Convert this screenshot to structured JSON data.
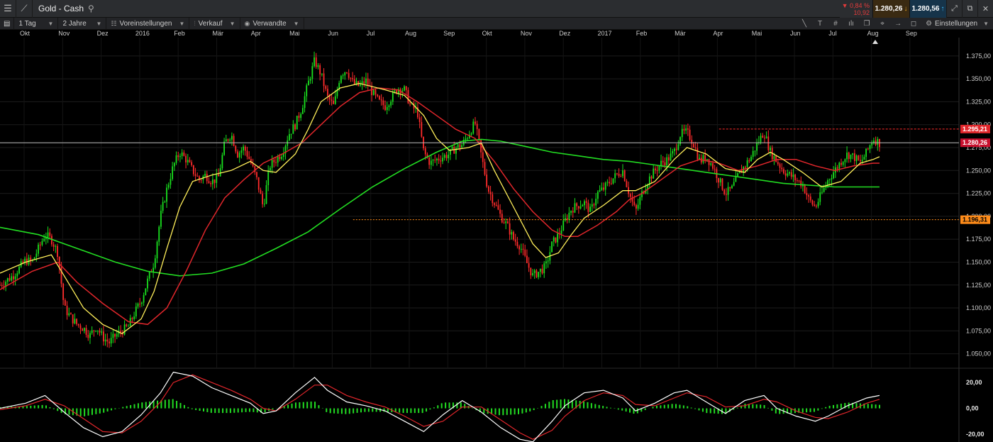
{
  "titlebar": {
    "instrument": "Gold - Cash",
    "change_pct": "▼ 0,84 %",
    "change_abs": "10,92",
    "bid": "1.280,26",
    "ask": "1.280,56"
  },
  "toolbar": {
    "interval": "1 Tag",
    "range": "2 Jahre",
    "presets": "Voreinstellungen",
    "sell": "Verkauf",
    "related": "Verwandte",
    "settings": "Einstellungen"
  },
  "months": [
    {
      "label": "Okt"
    },
    {
      "label": "Nov"
    },
    {
      "label": "Dez"
    },
    {
      "label": "2016"
    },
    {
      "label": "Feb"
    },
    {
      "label": "Mär"
    },
    {
      "label": "Apr"
    },
    {
      "label": "Mai"
    },
    {
      "label": "Jun"
    },
    {
      "label": "Jul"
    },
    {
      "label": "Aug"
    },
    {
      "label": "Sep"
    },
    {
      "label": "Okt"
    },
    {
      "label": "Nov"
    },
    {
      "label": "Dez"
    },
    {
      "label": "2017"
    },
    {
      "label": "Feb"
    },
    {
      "label": "Mär"
    },
    {
      "label": "Apr"
    },
    {
      "label": "Mai"
    },
    {
      "label": "Jun"
    },
    {
      "label": "Jul"
    },
    {
      "label": "Aug"
    },
    {
      "label": "Sep"
    }
  ],
  "colors": {
    "up": "#19e01e",
    "down": "#ff2b2b",
    "ma_fast": "#ffef5a",
    "ma_mid": "#e0262b",
    "ma_slow": "#22dd22",
    "osc_line": "#ffffff",
    "osc_signal": "#e0262b",
    "osc_hist": "#22dd22"
  },
  "chart_data": {
    "type": "candlestick",
    "instrument": "Gold - Cash",
    "interval": "1 Tag",
    "period": "2 Jahre",
    "y_ticks": [
      "1.375,00",
      "1.350,00",
      "1.325,00",
      "1.300,00",
      "1.275,00",
      "1.250,00",
      "1.225,00",
      "1.200,00",
      "1.175,00",
      "1.150,00",
      "1.125,00",
      "1.100,00",
      "1.075,00",
      "1.050,00"
    ],
    "ylim": [
      1035,
      1395
    ],
    "price_path": [
      [
        0,
        1125
      ],
      [
        2,
        1135
      ],
      [
        4,
        1152
      ],
      [
        5,
        1150
      ],
      [
        6,
        1165
      ],
      [
        7,
        1180
      ],
      [
        8,
        1175
      ],
      [
        9,
        1160
      ],
      [
        10,
        1100
      ],
      [
        11,
        1090
      ],
      [
        12,
        1082
      ],
      [
        13,
        1078
      ],
      [
        14,
        1070
      ],
      [
        15,
        1080
      ],
      [
        16,
        1068
      ],
      [
        17,
        1062
      ],
      [
        18,
        1070
      ],
      [
        19,
        1075
      ],
      [
        20,
        1080
      ],
      [
        21,
        1095
      ],
      [
        22,
        1108
      ],
      [
        23,
        1130
      ],
      [
        24,
        1150
      ],
      [
        25,
        1200
      ],
      [
        26,
        1230
      ],
      [
        27,
        1255
      ],
      [
        28,
        1270
      ],
      [
        29,
        1262
      ],
      [
        30,
        1250
      ],
      [
        31,
        1240
      ],
      [
        32,
        1245
      ],
      [
        33,
        1238
      ],
      [
        34,
        1242
      ],
      [
        35,
        1280
      ],
      [
        36,
        1290
      ],
      [
        37,
        1268
      ],
      [
        38,
        1275
      ],
      [
        39,
        1260
      ],
      [
        40,
        1240
      ],
      [
        41,
        1210
      ],
      [
        42,
        1255
      ],
      [
        43,
        1262
      ],
      [
        44,
        1270
      ],
      [
        45,
        1290
      ],
      [
        46,
        1300
      ],
      [
        47,
        1318
      ],
      [
        48,
        1345
      ],
      [
        49,
        1370
      ],
      [
        50,
        1355
      ],
      [
        51,
        1330
      ],
      [
        52,
        1320
      ],
      [
        53,
        1355
      ],
      [
        54,
        1360
      ],
      [
        55,
        1345
      ],
      [
        56,
        1342
      ],
      [
        57,
        1348
      ],
      [
        58,
        1335
      ],
      [
        59,
        1325
      ],
      [
        60,
        1320
      ],
      [
        61,
        1330
      ],
      [
        62,
        1340
      ],
      [
        63,
        1338
      ],
      [
        64,
        1320
      ],
      [
        65,
        1315
      ],
      [
        66,
        1270
      ],
      [
        67,
        1258
      ],
      [
        68,
        1262
      ],
      [
        69,
        1265
      ],
      [
        70,
        1268
      ],
      [
        71,
        1275
      ],
      [
        72,
        1278
      ],
      [
        73,
        1290
      ],
      [
        74,
        1302
      ],
      [
        75,
        1265
      ],
      [
        76,
        1230
      ],
      [
        77,
        1215
      ],
      [
        78,
        1200
      ],
      [
        79,
        1190
      ],
      [
        80,
        1175
      ],
      [
        81,
        1168
      ],
      [
        82,
        1150
      ],
      [
        83,
        1135
      ],
      [
        84,
        1140
      ],
      [
        85,
        1145
      ],
      [
        86,
        1170
      ],
      [
        87,
        1180
      ],
      [
        88,
        1195
      ],
      [
        89,
        1208
      ],
      [
        90,
        1212
      ],
      [
        91,
        1215
      ],
      [
        92,
        1205
      ],
      [
        93,
        1225
      ],
      [
        94,
        1230
      ],
      [
        95,
        1238
      ],
      [
        96,
        1245
      ],
      [
        97,
        1250
      ],
      [
        98,
        1225
      ],
      [
        99,
        1205
      ],
      [
        100,
        1225
      ],
      [
        101,
        1240
      ],
      [
        102,
        1250
      ],
      [
        103,
        1258
      ],
      [
        104,
        1262
      ],
      [
        105,
        1270
      ],
      [
        106,
        1290
      ],
      [
        107,
        1292
      ],
      [
        108,
        1280
      ],
      [
        109,
        1260
      ],
      [
        110,
        1265
      ],
      [
        111,
        1255
      ],
      [
        112,
        1240
      ],
      [
        113,
        1225
      ],
      [
        114,
        1230
      ],
      [
        115,
        1245
      ],
      [
        116,
        1255
      ],
      [
        117,
        1265
      ],
      [
        118,
        1280
      ],
      [
        119,
        1292
      ],
      [
        120,
        1270
      ],
      [
        121,
        1260
      ],
      [
        122,
        1250
      ],
      [
        123,
        1245
      ],
      [
        124,
        1240
      ],
      [
        125,
        1235
      ],
      [
        126,
        1218
      ],
      [
        127,
        1210
      ],
      [
        128,
        1225
      ],
      [
        129,
        1240
      ],
      [
        130,
        1250
      ],
      [
        131,
        1260
      ],
      [
        132,
        1268
      ],
      [
        133,
        1265
      ],
      [
        134,
        1258
      ],
      [
        135,
        1270
      ],
      [
        136,
        1285
      ],
      [
        137,
        1280
      ]
    ],
    "ma_fast": [
      [
        0,
        1138
      ],
      [
        4,
        1150
      ],
      [
        8,
        1158
      ],
      [
        10,
        1135
      ],
      [
        13,
        1100
      ],
      [
        16,
        1082
      ],
      [
        19,
        1072
      ],
      [
        22,
        1088
      ],
      [
        24,
        1118
      ],
      [
        26,
        1165
      ],
      [
        28,
        1210
      ],
      [
        30,
        1238
      ],
      [
        33,
        1245
      ],
      [
        36,
        1250
      ],
      [
        39,
        1260
      ],
      [
        41,
        1250
      ],
      [
        43,
        1248
      ],
      [
        46,
        1268
      ],
      [
        48,
        1295
      ],
      [
        50,
        1325
      ],
      [
        53,
        1340
      ],
      [
        56,
        1345
      ],
      [
        60,
        1338
      ],
      [
        63,
        1332
      ],
      [
        66,
        1310
      ],
      [
        68,
        1285
      ],
      [
        70,
        1272
      ],
      [
        73,
        1275
      ],
      [
        75,
        1280
      ],
      [
        77,
        1250
      ],
      [
        80,
        1210
      ],
      [
        83,
        1170
      ],
      [
        85,
        1155
      ],
      [
        87,
        1160
      ],
      [
        89,
        1180
      ],
      [
        91,
        1198
      ],
      [
        94,
        1212
      ],
      [
        97,
        1228
      ],
      [
        99,
        1228
      ],
      [
        102,
        1238
      ],
      [
        105,
        1262
      ],
      [
        107,
        1275
      ],
      [
        110,
        1268
      ],
      [
        113,
        1252
      ],
      [
        116,
        1248
      ],
      [
        118,
        1262
      ],
      [
        120,
        1270
      ],
      [
        122,
        1262
      ],
      [
        125,
        1248
      ],
      [
        128,
        1232
      ],
      [
        131,
        1238
      ],
      [
        134,
        1258
      ],
      [
        136,
        1262
      ],
      [
        137,
        1265
      ]
    ],
    "ma_mid": [
      [
        0,
        1120
      ],
      [
        5,
        1140
      ],
      [
        9,
        1150
      ],
      [
        12,
        1128
      ],
      [
        16,
        1105
      ],
      [
        20,
        1085
      ],
      [
        23,
        1082
      ],
      [
        26,
        1100
      ],
      [
        29,
        1140
      ],
      [
        32,
        1185
      ],
      [
        35,
        1220
      ],
      [
        38,
        1240
      ],
      [
        41,
        1258
      ],
      [
        44,
        1268
      ],
      [
        47,
        1280
      ],
      [
        50,
        1300
      ],
      [
        53,
        1320
      ],
      [
        56,
        1335
      ],
      [
        59,
        1340
      ],
      [
        62,
        1338
      ],
      [
        65,
        1325
      ],
      [
        68,
        1310
      ],
      [
        71,
        1295
      ],
      [
        74,
        1285
      ],
      [
        77,
        1260
      ],
      [
        80,
        1230
      ],
      [
        83,
        1205
      ],
      [
        86,
        1185
      ],
      [
        88,
        1178
      ],
      [
        90,
        1178
      ],
      [
        93,
        1190
      ],
      [
        96,
        1205
      ],
      [
        98,
        1218
      ],
      [
        100,
        1225
      ],
      [
        103,
        1240
      ],
      [
        106,
        1255
      ],
      [
        109,
        1262
      ],
      [
        112,
        1258
      ],
      [
        115,
        1250
      ],
      [
        118,
        1255
      ],
      [
        121,
        1262
      ],
      [
        124,
        1262
      ],
      [
        127,
        1255
      ],
      [
        130,
        1250
      ],
      [
        133,
        1255
      ],
      [
        136,
        1258
      ],
      [
        137,
        1258
      ]
    ],
    "ma_slow": [
      [
        0,
        1188
      ],
      [
        6,
        1180
      ],
      [
        12,
        1165
      ],
      [
        18,
        1150
      ],
      [
        23,
        1140
      ],
      [
        28,
        1135
      ],
      [
        33,
        1138
      ],
      [
        38,
        1148
      ],
      [
        43,
        1165
      ],
      [
        48,
        1183
      ],
      [
        53,
        1208
      ],
      [
        58,
        1232
      ],
      [
        63,
        1252
      ],
      [
        68,
        1270
      ],
      [
        72,
        1282
      ],
      [
        75,
        1284
      ],
      [
        78,
        1282
      ],
      [
        82,
        1276
      ],
      [
        86,
        1270
      ],
      [
        90,
        1266
      ],
      [
        94,
        1262
      ],
      [
        98,
        1260
      ],
      [
        102,
        1256
      ],
      [
        106,
        1252
      ],
      [
        110,
        1248
      ],
      [
        114,
        1244
      ],
      [
        118,
        1240
      ],
      [
        122,
        1236
      ],
      [
        126,
        1234
      ],
      [
        130,
        1232
      ],
      [
        134,
        1232
      ],
      [
        137,
        1232
      ]
    ],
    "support_level": "1.196,31",
    "resistance_level": "1.295,21",
    "current_level": "1.280,26",
    "oscillator": {
      "y_ticks": [
        "20,00",
        "0,00",
        "-20,00"
      ],
      "ylim": [
        -25,
        30
      ],
      "line": [
        [
          0,
          0
        ],
        [
          4,
          4
        ],
        [
          7,
          10
        ],
        [
          10,
          -3
        ],
        [
          13,
          -15
        ],
        [
          16,
          -22
        ],
        [
          19,
          -18
        ],
        [
          22,
          -5
        ],
        [
          25,
          12
        ],
        [
          27,
          28
        ],
        [
          30,
          25
        ],
        [
          33,
          16
        ],
        [
          36,
          10
        ],
        [
          39,
          4
        ],
        [
          41,
          -4
        ],
        [
          43,
          -2
        ],
        [
          46,
          12
        ],
        [
          49,
          24
        ],
        [
          51,
          14
        ],
        [
          54,
          5
        ],
        [
          57,
          2
        ],
        [
          60,
          -2
        ],
        [
          63,
          -10
        ],
        [
          66,
          -18
        ],
        [
          69,
          -5
        ],
        [
          72,
          6
        ],
        [
          75,
          -3
        ],
        [
          78,
          -15
        ],
        [
          81,
          -24
        ],
        [
          83,
          -26
        ],
        [
          86,
          -10
        ],
        [
          88,
          2
        ],
        [
          91,
          12
        ],
        [
          94,
          14
        ],
        [
          97,
          8
        ],
        [
          99,
          -2
        ],
        [
          102,
          4
        ],
        [
          105,
          12
        ],
        [
          107,
          14
        ],
        [
          110,
          5
        ],
        [
          113,
          -4
        ],
        [
          116,
          6
        ],
        [
          119,
          10
        ],
        [
          121,
          0
        ],
        [
          124,
          -6
        ],
        [
          127,
          -10
        ],
        [
          129,
          -6
        ],
        [
          132,
          2
        ],
        [
          135,
          8
        ],
        [
          137,
          10
        ]
      ],
      "signal": [
        [
          0,
          -1
        ],
        [
          4,
          2
        ],
        [
          7,
          7
        ],
        [
          10,
          2
        ],
        [
          13,
          -8
        ],
        [
          16,
          -18
        ],
        [
          19,
          -19
        ],
        [
          22,
          -10
        ],
        [
          25,
          5
        ],
        [
          27,
          20
        ],
        [
          30,
          26
        ],
        [
          33,
          20
        ],
        [
          36,
          14
        ],
        [
          39,
          7
        ],
        [
          41,
          0
        ],
        [
          43,
          -2
        ],
        [
          46,
          7
        ],
        [
          49,
          18
        ],
        [
          51,
          18
        ],
        [
          54,
          10
        ],
        [
          57,
          5
        ],
        [
          60,
          1
        ],
        [
          63,
          -6
        ],
        [
          66,
          -14
        ],
        [
          69,
          -10
        ],
        [
          72,
          1
        ],
        [
          75,
          1
        ],
        [
          78,
          -9
        ],
        [
          81,
          -19
        ],
        [
          83,
          -24
        ],
        [
          86,
          -17
        ],
        [
          88,
          -6
        ],
        [
          91,
          6
        ],
        [
          94,
          12
        ],
        [
          97,
          10
        ],
        [
          99,
          3
        ],
        [
          102,
          2
        ],
        [
          105,
          8
        ],
        [
          107,
          12
        ],
        [
          110,
          9
        ],
        [
          113,
          1
        ],
        [
          116,
          2
        ],
        [
          119,
          7
        ],
        [
          121,
          5
        ],
        [
          124,
          -2
        ],
        [
          127,
          -7
        ],
        [
          129,
          -8
        ],
        [
          132,
          -3
        ],
        [
          135,
          4
        ],
        [
          137,
          7
        ]
      ]
    }
  }
}
